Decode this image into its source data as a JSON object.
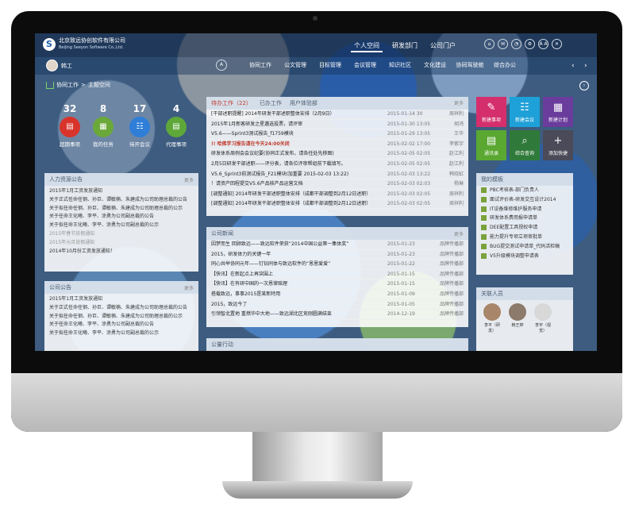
{
  "company": {
    "name": "北京致远协创软件有限公司",
    "en": "Beijing Seeyon Software Co.,Ltd."
  },
  "top_tabs": [
    "个人空间",
    "研发部门",
    "公司门户"
  ],
  "top_icons": [
    "⌂",
    "✉",
    "◔",
    "⚙",
    "A A",
    "✕"
  ],
  "user": {
    "name": "韩工"
  },
  "menu": {
    "icon": "A",
    "items": [
      "协同工作",
      "公文管理",
      "目标管理",
      "会议管理",
      "知识社区",
      "文化建设",
      "协同驾驶舱",
      "综合办公"
    ]
  },
  "breadcrumb": {
    "a": "协同工作",
    "b": "主题空间"
  },
  "stats": [
    {
      "n": "32",
      "label": "超期事项",
      "color": "#d9342b",
      "glyph": "▤"
    },
    {
      "n": "8",
      "label": "我的任务",
      "color": "#6aa83a",
      "glyph": "▦"
    },
    {
      "n": "17",
      "label": "待开会议",
      "color": "#2f7ed8",
      "glyph": "☷"
    },
    {
      "n": "4",
      "label": "代理事项",
      "color": "#5ea83a",
      "glyph": "▤"
    }
  ],
  "hr": {
    "title": "人力资源公告",
    "more": "更多",
    "items": [
      "2015年1月工资发放通知",
      "关于正式任命任钢、孙巨、谭敏楠、朱建成为公司助理总裁的公告",
      "关于拟任命任钢、孙巨、谭敏楠、朱建成为公司助理总裁的公示",
      "关于任命王化曦、李平、涂勇为公司副总裁的公告",
      "关于拟任命王化曦、李平、涂勇为公司副总裁的公示",
      "2015年春节放假通知",
      "2015年元旦放假通知",
      "2014年10月份工资发放通知！"
    ],
    "dim": [
      5,
      6
    ]
  },
  "company_notice": {
    "title": "公司公告",
    "more": "更多",
    "items": [
      "2015年1月工资发放通知",
      "关于正式任命任钢、孙巨、谭敏楠、朱建成为公司助理总裁的公告",
      "关于拟任命任钢、孙巨、谭敏楠、朱建成为公司助理总裁的公示",
      "关于任命王化曦、李平、涂勇为公司副总裁的公告",
      "关于拟任命王化曦、李平、涂勇为公司副总裁的公示"
    ]
  },
  "pending": {
    "tabs": [
      "待办工作（22）",
      "已办工作",
      "用户体验部"
    ],
    "more": "更多",
    "rows": [
      {
        "t": "[干部述职提醒] 2014年研发干部述职整体安排（2月9日）",
        "d": "2015-01-14 30",
        "w": "周祥利",
        "red": false
      },
      {
        "t": "2015年1月新客研发之星遴选投票，请评审",
        "d": "2015-01-30 13:05",
        "w": "胡鸿",
        "red": false
      },
      {
        "t": "V5.6——Sprint3测试报告_f1759模块",
        "d": "2015-01-29 13:05",
        "w": "王华",
        "red": false
      },
      {
        "t": "!! 哈佛学习报告请在今天24:00关闭",
        "d": "2015-02-02 17:00",
        "w": "李紫宇",
        "red": true
      },
      {
        "t": "研发体系周例会会议纪要(协同正式发布，请各任处先移图)",
        "d": "2015-02-05 02:05",
        "w": "赵江利",
        "red": false
      },
      {
        "t": "2月5日研发干部述职——评分表，请各位评审帮组前下载填写。",
        "d": "2015-02-05 02:05",
        "w": "赵江利",
        "red": false
      },
      {
        "t": "V5.6_Sprint3前测试报告_F21模块(加重要 2015-02-03 13:22)",
        "d": "2015-02-03 13:22",
        "w": "韩晓虹",
        "red": false
      },
      {
        "t": "！请资产回程提交V5.6产品核产品运营文档",
        "d": "2015-02-03 02:03",
        "w": "杨琳",
        "red": false
      },
      {
        "t": "[调整通知] 2014年研发干部述职整体安排（成都干部调整到2月12日述职）",
        "d": "2015-02-03 02:05",
        "w": "周祥利",
        "red": false
      },
      {
        "t": "[调整通知] 2014年研发干部述职整体安排（成都干部调整到2月12日述职）",
        "d": "2015-02-03 02:05",
        "w": "周祥利",
        "red": false
      }
    ]
  },
  "news": {
    "title": "公司新闻",
    "more": "更多",
    "rows": [
      {
        "t": "因梦而生 回顾致远——致远软件荣获“2014中国公益第一集体奖”",
        "d": "2015-01-23",
        "w": "品牌传播部"
      },
      {
        "t": "2015，研发体力的关键一年",
        "d": "2015-01-23",
        "w": "品牌传播部"
      },
      {
        "t": "同心共举协同元年——钉钻同体与致远软件的“恩恩爱爱”",
        "d": "2015-01-22",
        "w": "品牌传播部"
      },
      {
        "t": "【快讯】在新起点上再突围上",
        "d": "2015-01-15",
        "w": "品牌传播部"
      },
      {
        "t": "【快讯】在有研中国的一次恩律赔理",
        "d": "2015-01-15",
        "w": "品牌传播部"
      },
      {
        "t": "搭载致远，事事2015是某新特用",
        "d": "2015-01-09",
        "w": "品牌传播部"
      },
      {
        "t": "2015，致远今了",
        "d": "2015-01-05",
        "w": "品牌传播部"
      },
      {
        "t": "引领智北置地 重燃华中大地——致远湖北区竞刚圆满结束",
        "d": "2014-12-19",
        "w": "品牌传播部"
      }
    ]
  },
  "public_actions": {
    "title": "公量行动"
  },
  "tiles": [
    {
      "label": "新建事项",
      "color": "#d42f6c",
      "glyph": "✎"
    },
    {
      "label": "新建会议",
      "color": "#1ea0d8",
      "glyph": "☷"
    },
    {
      "label": "新建计划",
      "color": "#6a3c9c",
      "glyph": "▦"
    },
    {
      "label": "通讯录",
      "color": "#5aa832",
      "glyph": "▤"
    },
    {
      "label": "综合查询",
      "color": "#2f7a3a",
      "glyph": "⌕"
    },
    {
      "label": "添加快捷",
      "color": "#4a4a58",
      "glyph": "+"
    }
  ],
  "templates": {
    "title": "我的模板",
    "items": [
      "PBC考核表-部门负责人",
      "面试评价表-研发交互设计2014",
      "IT设备维修维护服务申请",
      "研发体系费用报申请单",
      "DEE配置工具授权申请",
      "能力提升专项立项审批单",
      "BUG提交测试申请单_代码活检稿",
      "V5升级模块调整申请表"
    ]
  },
  "people": {
    "title": "关联人员",
    "items": [
      "李平（研发）",
      "韩王婷",
      "李宇（视觉）"
    ]
  }
}
